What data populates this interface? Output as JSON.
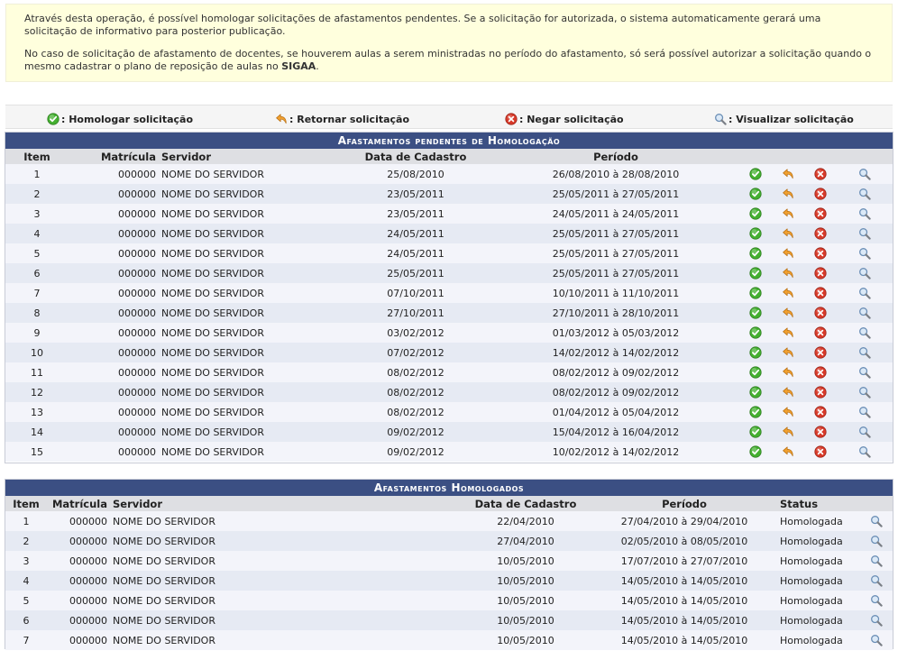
{
  "info": {
    "p1": "Através desta operação, é possível homologar solicitações de afastamentos pendentes. Se a solicitação for autorizada, o sistema automaticamente gerará uma solicitação de informativo para posterior publicação.",
    "p2_pre": "No caso de solicitação de afastamento de docentes, se houverem aulas a serem ministradas no período do afastamento, só será possível autorizar a solicitação quando o mesmo cadastrar o plano de reposição de aulas no ",
    "p2_bold": "SIGAA",
    "p2_post": "."
  },
  "legend": {
    "approve": ": Homologar solicitação",
    "return": ": Retornar solicitação",
    "deny": ": Negar solicitação",
    "view": ": Visualizar solicitação"
  },
  "pending": {
    "caption": "Afastamentos pendentes de Homologação",
    "headers": {
      "item": "Item",
      "matricula": "Matrícula",
      "servidor": "Servidor",
      "cadastro": "Data de Cadastro",
      "periodo": "Período"
    },
    "rows": [
      {
        "item": "1",
        "matricula": "000000",
        "servidor": "NOME DO SERVIDOR",
        "cadastro": "25/08/2010",
        "periodo": "26/08/2010 à 28/08/2010"
      },
      {
        "item": "2",
        "matricula": "000000",
        "servidor": "NOME DO SERVIDOR",
        "cadastro": "23/05/2011",
        "periodo": "25/05/2011 à 27/05/2011"
      },
      {
        "item": "3",
        "matricula": "000000",
        "servidor": "NOME DO SERVIDOR",
        "cadastro": "23/05/2011",
        "periodo": "24/05/2011 à 24/05/2011"
      },
      {
        "item": "4",
        "matricula": "000000",
        "servidor": "NOME DO SERVIDOR",
        "cadastro": "24/05/2011",
        "periodo": "25/05/2011 à 27/05/2011"
      },
      {
        "item": "5",
        "matricula": "000000",
        "servidor": "NOME DO SERVIDOR",
        "cadastro": "24/05/2011",
        "periodo": "25/05/2011 à 27/05/2011"
      },
      {
        "item": "6",
        "matricula": "000000",
        "servidor": "NOME DO SERVIDOR",
        "cadastro": "25/05/2011",
        "periodo": "25/05/2011 à 27/05/2011"
      },
      {
        "item": "7",
        "matricula": "000000",
        "servidor": "NOME DO SERVIDOR",
        "cadastro": "07/10/2011",
        "periodo": "10/10/2011 à 11/10/2011"
      },
      {
        "item": "8",
        "matricula": "000000",
        "servidor": "NOME DO SERVIDOR",
        "cadastro": "27/10/2011",
        "periodo": "27/10/2011 à 28/10/2011"
      },
      {
        "item": "9",
        "matricula": "000000",
        "servidor": "NOME DO SERVIDOR",
        "cadastro": "03/02/2012",
        "periodo": "01/03/2012 à 05/03/2012"
      },
      {
        "item": "10",
        "matricula": "000000",
        "servidor": "NOME DO SERVIDOR",
        "cadastro": "07/02/2012",
        "periodo": "14/02/2012 à 14/02/2012"
      },
      {
        "item": "11",
        "matricula": "000000",
        "servidor": "NOME DO SERVIDOR",
        "cadastro": "08/02/2012",
        "periodo": "08/02/2012 à 09/02/2012"
      },
      {
        "item": "12",
        "matricula": "000000",
        "servidor": "NOME DO SERVIDOR",
        "cadastro": "08/02/2012",
        "periodo": "08/02/2012 à 09/02/2012"
      },
      {
        "item": "13",
        "matricula": "000000",
        "servidor": "NOME DO SERVIDOR",
        "cadastro": "08/02/2012",
        "periodo": "01/04/2012 à 05/04/2012"
      },
      {
        "item": "14",
        "matricula": "000000",
        "servidor": "NOME DO SERVIDOR",
        "cadastro": "09/02/2012",
        "periodo": "15/04/2012 à 16/04/2012"
      },
      {
        "item": "15",
        "matricula": "000000",
        "servidor": "NOME DO SERVIDOR",
        "cadastro": "09/02/2012",
        "periodo": "10/02/2012 à 14/02/2012"
      }
    ]
  },
  "approved": {
    "caption": "Afastamentos Homologados",
    "headers": {
      "item": "Item",
      "matricula": "Matrícula",
      "servidor": "Servidor",
      "cadastro": "Data de Cadastro",
      "periodo": "Período",
      "status": "Status"
    },
    "rows": [
      {
        "item": "1",
        "matricula": "000000",
        "servidor": "NOME DO SERVIDOR",
        "cadastro": "22/04/2010",
        "periodo": "27/04/2010 à 29/04/2010",
        "status": "Homologada"
      },
      {
        "item": "2",
        "matricula": "000000",
        "servidor": "NOME DO SERVIDOR",
        "cadastro": "27/04/2010",
        "periodo": "02/05/2010 à 08/05/2010",
        "status": "Homologada"
      },
      {
        "item": "3",
        "matricula": "000000",
        "servidor": "NOME DO SERVIDOR",
        "cadastro": "10/05/2010",
        "periodo": "17/07/2010 à 27/07/2010",
        "status": "Homologada"
      },
      {
        "item": "4",
        "matricula": "000000",
        "servidor": "NOME DO SERVIDOR",
        "cadastro": "10/05/2010",
        "periodo": "14/05/2010 à 14/05/2010",
        "status": "Homologada"
      },
      {
        "item": "5",
        "matricula": "000000",
        "servidor": "NOME DO SERVIDOR",
        "cadastro": "10/05/2010",
        "periodo": "14/05/2010 à 14/05/2010",
        "status": "Homologada"
      },
      {
        "item": "6",
        "matricula": "000000",
        "servidor": "NOME DO SERVIDOR",
        "cadastro": "10/05/2010",
        "periodo": "14/05/2010 à 14/05/2010",
        "status": "Homologada"
      },
      {
        "item": "7",
        "matricula": "000000",
        "servidor": "NOME DO SERVIDOR",
        "cadastro": "10/05/2010",
        "periodo": "14/05/2010 à 14/05/2010",
        "status": "Homologada"
      }
    ]
  },
  "colors": {
    "header_bar": "#3b4f83",
    "column_header": "#dedfe3",
    "row_odd": "#f3f4fa",
    "row_even": "#e6eaf3",
    "info_bg": "#ffffdd",
    "approve_icon": "#44b030",
    "return_icon": "#f0a030",
    "deny_icon": "#d83a2a"
  },
  "icons": {
    "approve": "check-circle-icon",
    "return": "return-arrow-icon",
    "deny": "x-circle-icon",
    "view": "magnifier-icon"
  }
}
